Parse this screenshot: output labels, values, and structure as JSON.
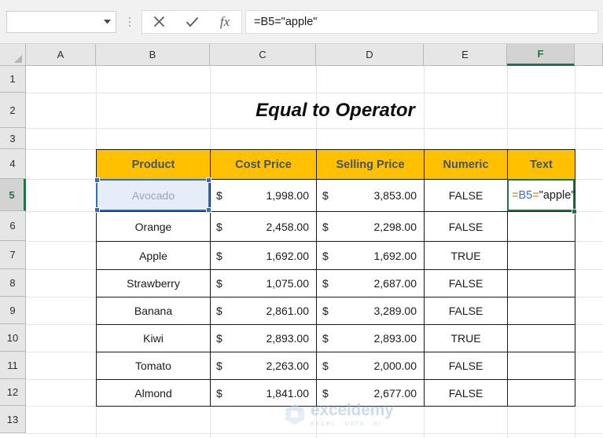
{
  "formula_bar": {
    "name_box_value": "",
    "name_box_placeholder": "",
    "dropdown_icon": "chevron-down-icon",
    "cancel_icon": "cancel-x-icon",
    "confirm_icon": "confirm-check-icon",
    "insert_function_icon": "fx-icon",
    "insert_function_label": "fx",
    "formula_value": "=B5=\"apple\""
  },
  "grid": {
    "columns": [
      "A",
      "B",
      "C",
      "D",
      "E",
      "F"
    ],
    "active_column": "F",
    "rows": [
      "1",
      "2",
      "3",
      "4",
      "5",
      "6",
      "7",
      "8",
      "9",
      "10",
      "11",
      "12",
      "13"
    ],
    "active_row": "5"
  },
  "title": {
    "text": "Equal to Operator"
  },
  "table": {
    "headers": [
      "Product",
      "Cost Price",
      "Selling Price",
      "Numeric",
      "Text"
    ],
    "rows": [
      {
        "product": "Avocado",
        "cost_currency": "$",
        "cost": "1,998.00",
        "sell_currency": "$",
        "sell": "3,853.00",
        "numeric": "FALSE",
        "text": ""
      },
      {
        "product": "Orange",
        "cost_currency": "$",
        "cost": "2,458.00",
        "sell_currency": "$",
        "sell": "2,298.00",
        "numeric": "FALSE",
        "text": ""
      },
      {
        "product": "Apple",
        "cost_currency": "$",
        "cost": "1,692.00",
        "sell_currency": "$",
        "sell": "1,692.00",
        "numeric": "TRUE",
        "text": ""
      },
      {
        "product": "Strawberry",
        "cost_currency": "$",
        "cost": "1,075.00",
        "sell_currency": "$",
        "sell": "2,687.00",
        "numeric": "FALSE",
        "text": ""
      },
      {
        "product": "Banana",
        "cost_currency": "$",
        "cost": "2,861.00",
        "sell_currency": "$",
        "sell": "3,289.00",
        "numeric": "FALSE",
        "text": ""
      },
      {
        "product": "Kiwi",
        "cost_currency": "$",
        "cost": "2,893.00",
        "sell_currency": "$",
        "sell": "2,893.00",
        "numeric": "TRUE",
        "text": ""
      },
      {
        "product": "Tomato",
        "cost_currency": "$",
        "cost": "2,263.00",
        "sell_currency": "$",
        "sell": "2,000.00",
        "numeric": "FALSE",
        "text": ""
      },
      {
        "product": "Almond",
        "cost_currency": "$",
        "cost": "1,841.00",
        "sell_currency": "$",
        "sell": "2,677.00",
        "numeric": "FALSE",
        "text": ""
      }
    ]
  },
  "editing_cell": {
    "address": "F5",
    "token_eq1": "=",
    "token_ref": "B5",
    "token_eq2": "=",
    "token_string": "\"apple\""
  },
  "reference_highlight": {
    "address": "B5",
    "value": "Avocado"
  },
  "watermark": {
    "name": "exceldemy",
    "tagline": "EXCEL · DATA · BI"
  },
  "colors": {
    "header_fill": "#FFC000",
    "header_text": "#44546A",
    "active_green": "#217346",
    "reference_blue": "#2a6fd0",
    "watermark_blue": "#9cb8de"
  }
}
